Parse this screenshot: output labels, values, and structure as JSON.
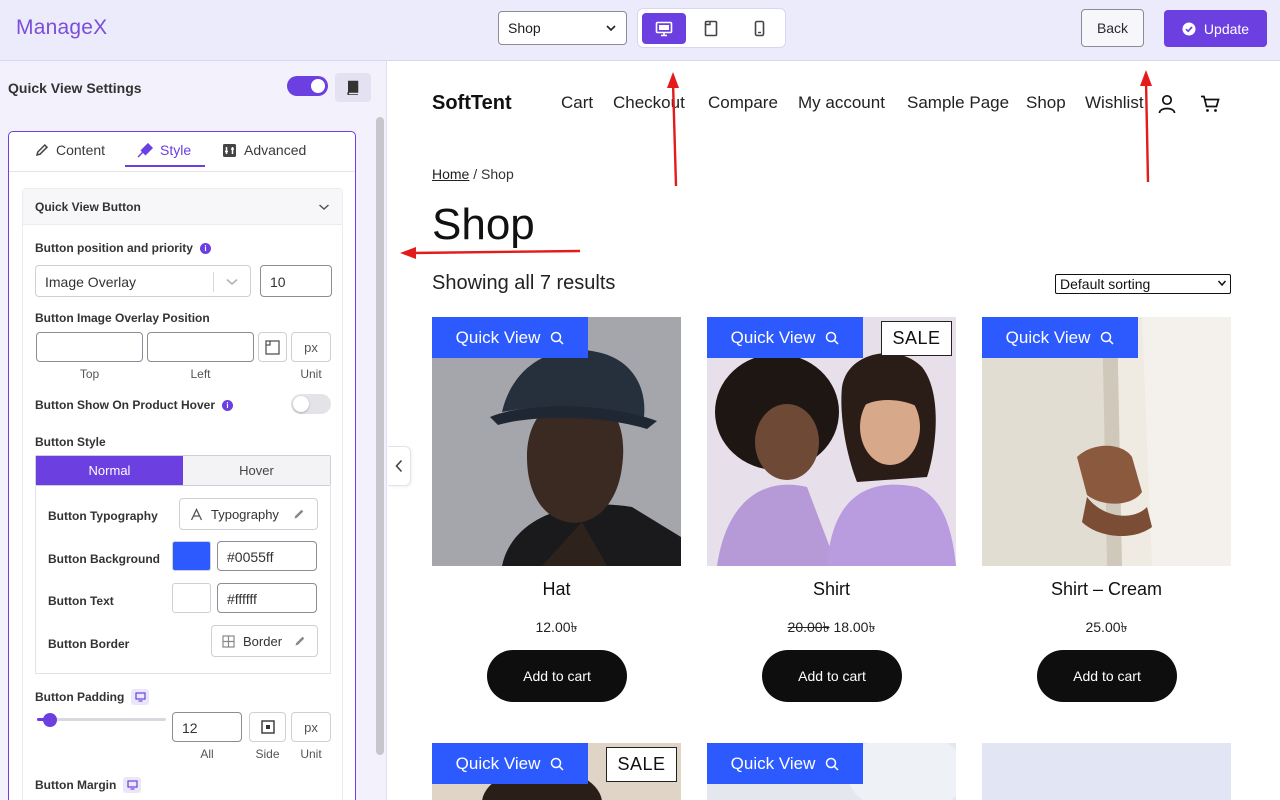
{
  "app": {
    "logo": "ManageX"
  },
  "toolbar": {
    "page_select": "Shop",
    "back_label": "Back",
    "update_label": "Update"
  },
  "panel": {
    "title": "Quick View Settings",
    "tabs": [
      "Content",
      "Style",
      "Advanced"
    ],
    "active_tab": "Style",
    "section_title": "Quick View Button",
    "position_label": "Button position and priority",
    "position_value": "Image Overlay",
    "priority_value": "10",
    "overlay_label": "Button Image Overlay Position",
    "overlay_top_label": "Top",
    "overlay_left_label": "Left",
    "overlay_unit_label": "Unit",
    "unit_px": "px",
    "hover_label": "Button Show On Product Hover",
    "style_label": "Button Style",
    "state_tabs": [
      "Normal",
      "Hover"
    ],
    "typography_label": "Button Typography",
    "typography_btn": "Typography",
    "background_label": "Button Background",
    "background_value": "#0055ff",
    "text_label": "Button Text",
    "text_value": "#ffffff",
    "border_label": "Button Border",
    "border_btn": "Border",
    "padding_label": "Button Padding",
    "padding_value": "12",
    "padding_all_label": "All",
    "padding_side_label": "Side",
    "padding_unit_label": "Unit",
    "margin_label": "Button Margin"
  },
  "preview": {
    "site_title": "SoftTent",
    "nav": [
      "Cart",
      "Checkout",
      "Compare",
      "My account",
      "Sample Page",
      "Shop",
      "Wishlist"
    ],
    "breadcrumb_home": "Home",
    "breadcrumb_sep": " / ",
    "breadcrumb_current": "Shop",
    "page_title": "Shop",
    "result_count": "Showing all 7 results",
    "sort_value": "Default sorting",
    "quick_view_label": "Quick View",
    "sale_label": "SALE",
    "add_to_cart_label": "Add to cart",
    "products": [
      {
        "name": "Hat",
        "price": "12.00৳",
        "old_price": ""
      },
      {
        "name": "Shirt",
        "price": "18.00৳",
        "old_price": "20.00৳"
      },
      {
        "name": "Shirt – Cream",
        "price": "25.00৳",
        "old_price": ""
      }
    ]
  },
  "colors": {
    "accent": "#6c3fe0",
    "quick_view_bg": "#2c5aff",
    "button_dark": "#0e0e0e",
    "annotation_arrow": "#e31b1b"
  }
}
